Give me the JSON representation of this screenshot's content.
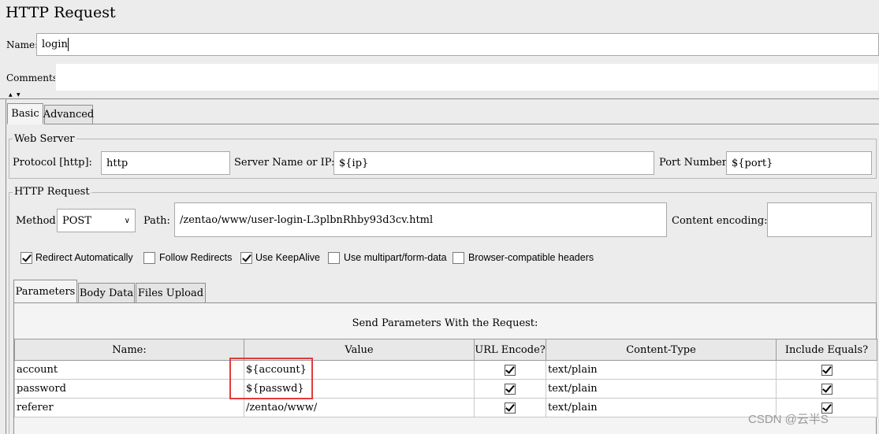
{
  "window": {
    "title": "HTTP Request",
    "name_label": "Name:",
    "name_value": "login",
    "comments_label": "Comments:"
  },
  "tabs": {
    "basic": "Basic",
    "advanced": "Advanced"
  },
  "web_server": {
    "legend": "Web Server",
    "protocol_label": "Protocol [http]:",
    "protocol_value": "http",
    "server_label": "Server Name or IP:",
    "server_value": "${ip}",
    "port_label": "Port Number:",
    "port_value": "${port}"
  },
  "http_request": {
    "legend": "HTTP Request",
    "method_label": "Method:",
    "method_value": "POST",
    "path_label": "Path:",
    "path_value": "/zentao/www/user-login-L3plbnRhby93d3cv.html",
    "encoding_label": "Content encoding:",
    "encoding_value": ""
  },
  "options": [
    {
      "label": "Redirect Automatically",
      "checked": true
    },
    {
      "label": "Follow Redirects",
      "checked": false
    },
    {
      "label": "Use KeepAlive",
      "checked": true
    },
    {
      "label": "Use multipart/form-data",
      "checked": false
    },
    {
      "label": "Browser-compatible headers",
      "checked": false
    }
  ],
  "subtabs": {
    "parameters": "Parameters",
    "body_data": "Body Data",
    "files_upload": "Files Upload"
  },
  "params_table": {
    "caption": "Send Parameters With the Request:",
    "columns": [
      "Name:",
      "Value",
      "URL Encode?",
      "Content-Type",
      "Include Equals?"
    ],
    "rows": [
      {
        "name": "account",
        "value": "${account}",
        "url_encode": true,
        "content_type": "text/plain",
        "include_equals": true
      },
      {
        "name": "password",
        "value": "${passwd}",
        "url_encode": true,
        "content_type": "text/plain",
        "include_equals": true
      },
      {
        "name": "referer",
        "value": "/zentao/www/",
        "url_encode": true,
        "content_type": "text/plain",
        "include_equals": true
      }
    ]
  },
  "watermark": "CSDN @云半S",
  "colors": {
    "highlight_box": "#e23b3b",
    "panel_bg": "#ececec"
  }
}
